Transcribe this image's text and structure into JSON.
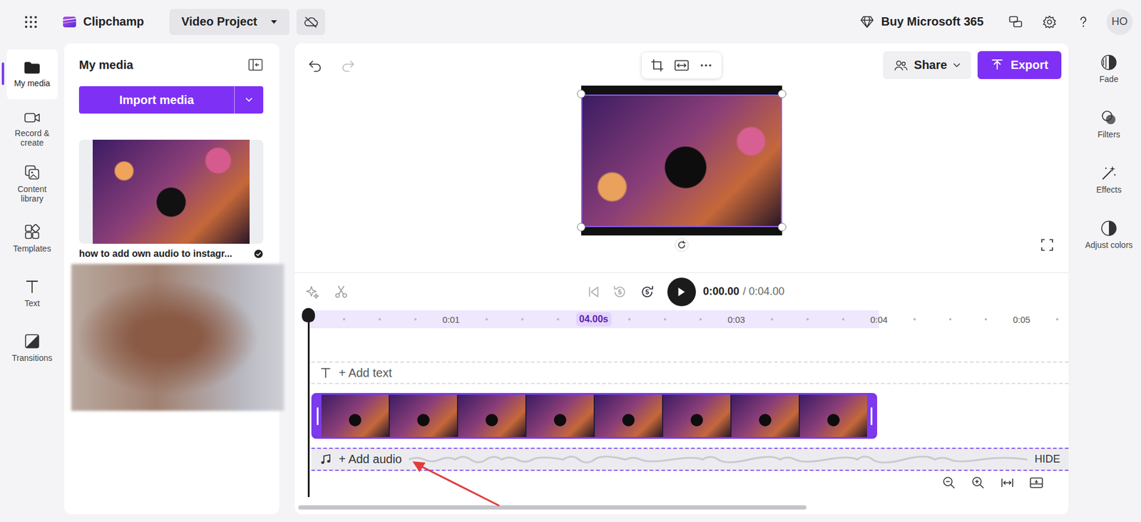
{
  "app": {
    "name": "Clipchamp",
    "project": "Video Project",
    "upsell": "Buy Microsoft 365",
    "avatar": "HO"
  },
  "nav": [
    {
      "label": "My media",
      "selected": true
    },
    {
      "label": "Record & create",
      "selected": false
    },
    {
      "label": "Content library",
      "selected": false
    },
    {
      "label": "Templates",
      "selected": false
    },
    {
      "label": "Text",
      "selected": false
    },
    {
      "label": "Transitions",
      "selected": false
    }
  ],
  "media_panel": {
    "title": "My media",
    "import_button": "Import media",
    "items": [
      {
        "kind": "thumbnail",
        "label": "how to add own audio to instagr...",
        "checked": true
      },
      {
        "kind": "blurred",
        "checked": false
      }
    ]
  },
  "toolbar": {
    "share": "Share",
    "export": "Export"
  },
  "preview": {
    "selected": true
  },
  "playback": {
    "skip_seconds": "5",
    "back_enabled": false,
    "forward_enabled": true,
    "time": "0:00.00",
    "duration": "/ 0:04.00"
  },
  "ruler": [
    {
      "label": "0:01",
      "kind": "tick",
      "in_project": true
    },
    {
      "label": "04.00s",
      "kind": "badge",
      "in_project": true
    },
    {
      "label": "0:03",
      "kind": "tick",
      "in_project": true
    },
    {
      "label": "0:04",
      "kind": "tick",
      "in_project": true
    },
    {
      "label": "0:05",
      "kind": "tick",
      "in_project": false
    }
  ],
  "playhead_level": 0,
  "tracks": {
    "text": "+ Add text",
    "audio": "+ Add audio",
    "audio_hide": "HIDE",
    "audio_selected": true,
    "clip_selected": true
  },
  "effects": [
    {
      "label": "Fade"
    },
    {
      "label": "Filters"
    },
    {
      "label": "Effects"
    },
    {
      "label": "Adjust colors"
    }
  ]
}
